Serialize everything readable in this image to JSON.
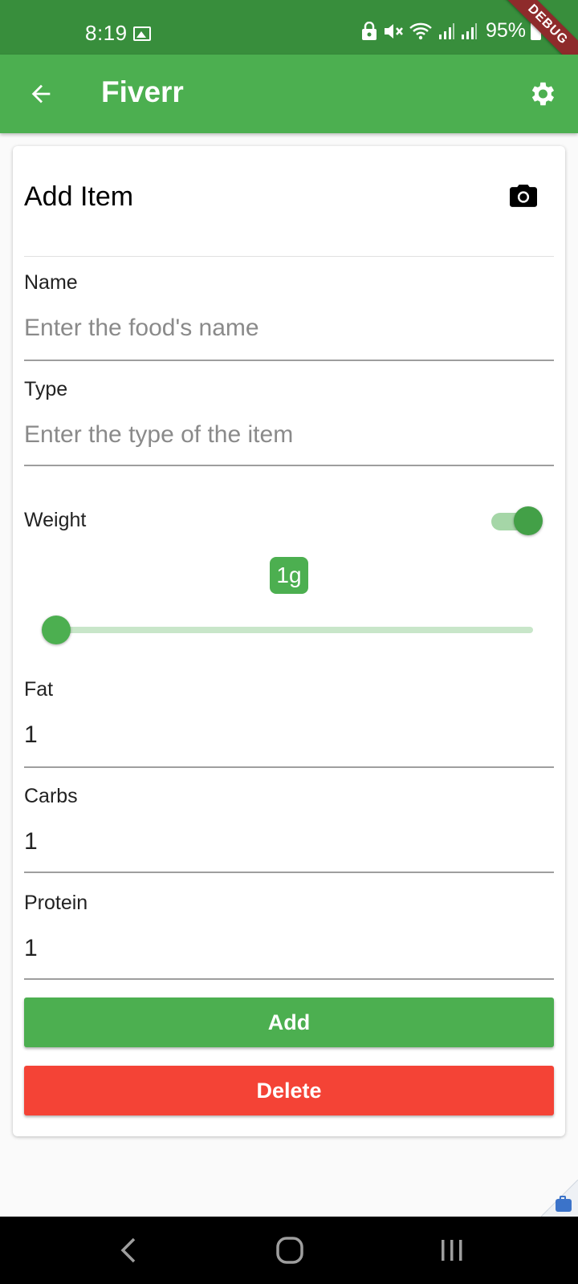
{
  "status_bar": {
    "time": "8:19",
    "battery_percent": "95%",
    "debug_label": "DEBUG"
  },
  "app_bar": {
    "title": "Fiverr"
  },
  "card": {
    "title": "Add Item",
    "fields": {
      "name": {
        "label": "Name",
        "placeholder": "Enter the food's name",
        "value": ""
      },
      "type": {
        "label": "Type",
        "placeholder": "Enter the type of the item",
        "value": ""
      },
      "fat": {
        "label": "Fat",
        "value": "1"
      },
      "carbs": {
        "label": "Carbs",
        "value": "1"
      },
      "protein": {
        "label": "Protein",
        "value": "1"
      }
    },
    "weight": {
      "label": "Weight",
      "enabled": true,
      "slider_value_label": "1g",
      "slider_fraction": 0.0
    },
    "buttons": {
      "add": "Add",
      "delete": "Delete"
    }
  },
  "colors": {
    "primary": "#4caf50",
    "primary_dark": "#388e3c",
    "danger": "#f44336"
  },
  "icons": [
    "back-arrow-icon",
    "settings-gear-icon",
    "camera-icon",
    "gallery-icon",
    "lock-icon",
    "mute-icon",
    "wifi-icon",
    "signal-icon",
    "battery-icon",
    "nav-back-icon",
    "nav-home-icon",
    "nav-recents-icon"
  ]
}
